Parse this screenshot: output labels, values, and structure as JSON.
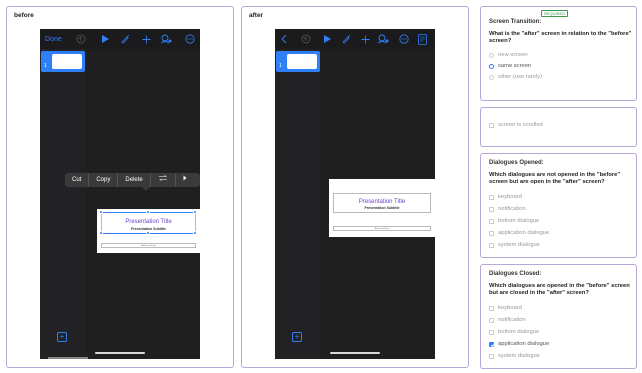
{
  "before": {
    "title": "before",
    "toolbar": {
      "done_label": "Done"
    },
    "thumb_number": "1",
    "context_menu": {
      "cut": "Cut",
      "copy": "Copy",
      "delete": "Delete"
    },
    "slide": {
      "title": "Presentation Title",
      "subtitle": "Presentation Subtitle",
      "footer": "Author and Date"
    }
  },
  "after": {
    "title": "after",
    "thumb_number": "1",
    "slide": {
      "title": "Presentation Title",
      "subtitle": "Presentation Subtitle",
      "footer": "Author and Date"
    }
  },
  "accent_color": "#2f7ff6",
  "form": {
    "transition": {
      "heading": "Screen Transition:",
      "required": "REQUIRED",
      "question": "What is the \"after\" screen in relation to the \"before\" screen?",
      "options": [
        "new screen",
        "same screen",
        "other (use rarely)"
      ],
      "selected": "same screen"
    },
    "scroll": {
      "option": "screen is scrolled",
      "checked": false
    },
    "opened": {
      "heading": "Dialogues Opened:",
      "question": "Which dialogues are not opened in the \"before\" screen but are open in the \"after\" screen?",
      "options": [
        "keyboard",
        "notification",
        "bottom dialogue",
        "application dialogue",
        "system dialogue"
      ],
      "checked": []
    },
    "closed": {
      "heading": "Dialogues Closed:",
      "question": "Which dialogues are opened in the \"before\" screen but are closed in the \"after\" screen?",
      "options": [
        "keyboard",
        "notification",
        "bottom dialogue",
        "application dialogue",
        "system dialogue"
      ],
      "checked": [
        "application dialogue"
      ]
    }
  }
}
